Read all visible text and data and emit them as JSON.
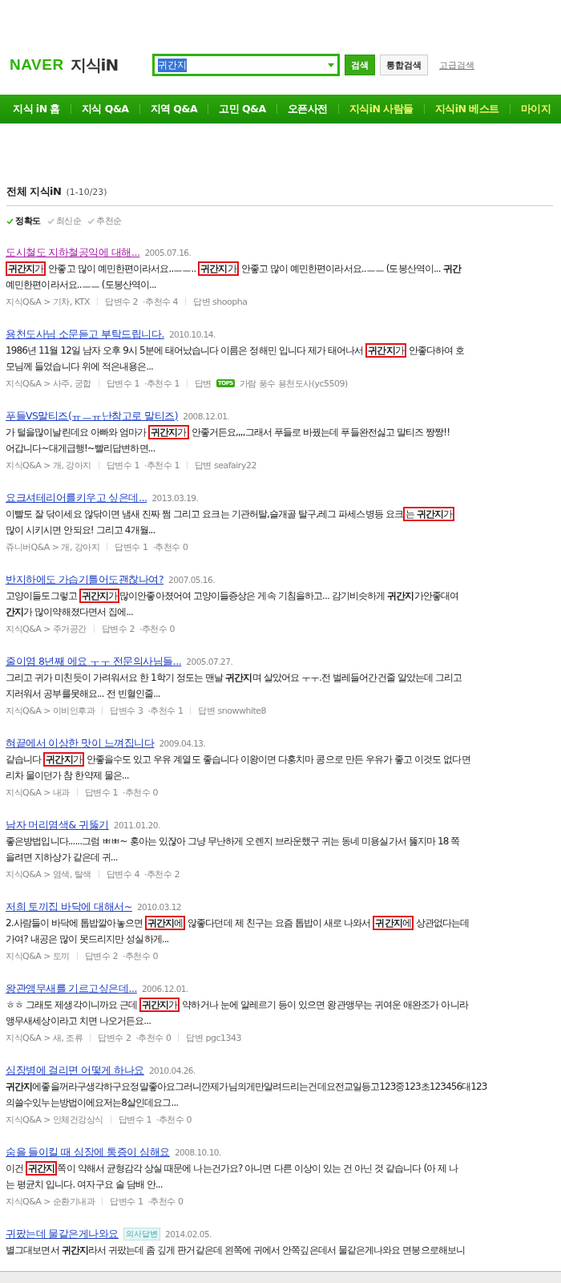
{
  "header": {
    "logo_brand": "NAVER",
    "logo_service": "지식iN",
    "search": {
      "value": "귀간지"
    },
    "buttons": [
      {
        "label": "검색",
        "kind": "primary"
      },
      {
        "label": "통합검색",
        "kind": "secondary"
      }
    ],
    "advanced_link": "고급검색"
  },
  "nav": [
    {
      "label": "지식 iN 홈",
      "kind": "main"
    },
    {
      "label": "지식 Q&A",
      "kind": "main"
    },
    {
      "label": "지역 Q&A",
      "kind": "main"
    },
    {
      "label": "고민 Q&A",
      "kind": "main"
    },
    {
      "label": "오픈사전",
      "kind": "main"
    },
    {
      "label": "지식iN 사람들",
      "kind": "special"
    },
    {
      "label": "지식iN 베스트",
      "kind": "special"
    },
    {
      "label": "마이지",
      "kind": "special"
    }
  ],
  "section": {
    "title": "전체 지식iN",
    "range": "(1-10/23)"
  },
  "sort": [
    {
      "label": "정확도",
      "selected": true
    },
    {
      "label": "최신순",
      "selected": false
    },
    {
      "label": "추천순",
      "selected": false
    }
  ],
  "results": [
    {
      "title": "도시철도 지하철공익에 대해...",
      "visited": true,
      "date": "2005.07.16.",
      "lines": [
        [
          {
            "text": "**귀간지**가",
            "kind": "boxed"
          },
          {
            "text": " 안좋고 많이 예민한편이라서요..ㅡㅡ.. ",
            "kind": "plain"
          },
          {
            "text": "**귀간지**가",
            "kind": "boxed"
          },
          {
            "text": " 안좋고 많이 예민한편이라서요..ㅡㅡ (도봉산역이... **귀간**",
            "kind": "plain"
          }
        ],
        [
          {
            "text": "예민한편이라서요..ㅡㅡ (도봉산역이...",
            "kind": "plain"
          }
        ]
      ],
      "category": "지식Q&A > 기차, KTX",
      "answers": "답변수 2",
      "recommends": "·추천수 4",
      "answerer": "답변 shoopha"
    },
    {
      "title": "용천도사님 소문듣고 부탁드립니다.",
      "visited": false,
      "date": "2010.10.14.",
      "lines": [
        [
          {
            "text": "1986년 11월 12일 남자 오후 9시 5분에 태어났습니다 이름은 정해민 입니다 제가 태어나서 ",
            "kind": "plain"
          },
          {
            "text": "**귀간지**가",
            "kind": "boxed"
          },
          {
            "text": " 안좋다하여 호",
            "kind": "plain"
          }
        ],
        [
          {
            "text": "모님께 들었습니다 위에 적은내용은...",
            "kind": "plain"
          }
        ]
      ],
      "category": "지식Q&A > 사주, 궁합",
      "answers": "답변수 1",
      "recommends": "·추천수 1",
      "answerer": "답변",
      "answerer_badge": "TOP5",
      "answerer_name": "가람 풍수 용천도사(yc5509)"
    },
    {
      "title": "푸들VS말티즈(ㅠㅡㅠ난참고로 말티즈)",
      "visited": false,
      "date": "2008.12.01.",
      "lines": [
        [
          {
            "text": "가 털을많이날린데요 아빠와 엄마가 ",
            "kind": "plain"
          },
          {
            "text": "**귀간지**가",
            "kind": "boxed"
          },
          {
            "text": " 안좋거든요,,,,그래서 푸들로 바꿨는데 푸들완전싫고 말티즈 짱짱!!",
            "kind": "plain"
          }
        ],
        [
          {
            "text": "어갑니다~대게급행!~빨리답변하면...",
            "kind": "plain"
          }
        ]
      ],
      "category": "지식Q&A > 개, 강아지",
      "answers": "답변수 1",
      "recommends": "·추천수 1",
      "answerer": "답변 seafairy22"
    },
    {
      "title": "요크셔테리어를키우고 싶은데...",
      "visited": false,
      "date": "2013.03.19.",
      "lines": [
        [
          {
            "text": "이빨도 잘 닦이세요 않닦이면 냄새 진짜 쩜 그리고 요크는 기관허탈,슬개골 탈구,레그 파세스병등 요크",
            "kind": "plain"
          },
          {
            "text": "는 **귀간지**가",
            "kind": "boxed"
          }
        ],
        [
          {
            "text": "많이 시키시면 안되요! 그리고 4개월...",
            "kind": "plain"
          }
        ]
      ],
      "category": "쥬니버Q&A > 개, 강아지",
      "answers": "답변수 1",
      "recommends": "·추천수 0"
    },
    {
      "title": "반지하에도 가습기틀어도괜찮나여?",
      "visited": false,
      "date": "2007.05.16.",
      "lines": [
        [
          {
            "text": "고양이들도그렇고 ",
            "kind": "plain"
          },
          {
            "text": "**귀간지**가",
            "kind": "boxed"
          },
          {
            "text": "많이안좋아졌어여 고양이들증상은 게속 기침을하고... 감기비슷하게 **귀간지**가안좋대여",
            "kind": "plain"
          }
        ],
        [
          {
            "text": "**간지**가 많이약해졌다면서 집에...",
            "kind": "plain"
          }
        ]
      ],
      "category": "지식Q&A > 주거공간",
      "answers": "답변수 2",
      "recommends": "·추천수 0"
    },
    {
      "title": "줄이염 8년째 에요 ㅜㅜ 전문의사님들...",
      "visited": false,
      "date": "2005.07.27.",
      "lines": [
        [
          {
            "text": "그리고 귀가 미친듯이 가려워서요 한 1학기 정도는 맨날 **귀간지**며 살았어요 ㅜㅜ.전 벌레들어간건줄 알았는데 그리고",
            "kind": "plain"
          }
        ],
        [
          {
            "text": "지러워서 공부를못해요... 전 빈혈인줄...",
            "kind": "plain"
          }
        ]
      ],
      "category": "지식Q&A > 이비인후과",
      "answers": "답변수 3",
      "recommends": "·추천수 1",
      "answerer": "답변 snowwhite8"
    },
    {
      "title": "혀끝에서 이상한 맛이 느껴집니다",
      "visited": false,
      "date": "2009.04.13.",
      "lines": [
        [
          {
            "text": "같습니다 ",
            "kind": "plain"
          },
          {
            "text": "**귀간지**가",
            "kind": "boxed"
          },
          {
            "text": " 안좋을수도 있고 우유 계열도 좋습니다 이왕이면 다홍치마 콩으로 만든 우유가 좋고 이것도 없다면",
            "kind": "plain"
          }
        ],
        [
          {
            "text": "리차 물이던가 참 한약제 물은...",
            "kind": "plain"
          }
        ]
      ],
      "category": "지식Q&A > 내과",
      "answers": "답변수 1",
      "recommends": "·추천수 0"
    },
    {
      "title": "남자 머리염색& 귀뚫기",
      "visited": false,
      "date": "2011.01.20.",
      "lines": [
        [
          {
            "text": "좋은방법입니다......그럼 ㅃㅃ~ 홍아는 있잖아 그냥 무난하게 오렌지 브라운했구 귀는 동네 미용실가서 뚫지마 18 쪽",
            "kind": "plain"
          }
        ],
        [
          {
            "text": "을려면 지하상가 같은데 귀...",
            "kind": "plain"
          }
        ]
      ],
      "category": "지식Q&A > 염색, 탈색",
      "answers": "답변수 4",
      "recommends": "·추천수 2"
    },
    {
      "title": "저희 토끼집 바닥에 대해서~",
      "visited": false,
      "date": "2010.03.12",
      "lines": [
        [
          {
            "text": "2.사람들이 바닥에 톱밥깔아놓으면 ",
            "kind": "plain"
          },
          {
            "text": "**귀간지**에",
            "kind": "boxed"
          },
          {
            "text": " 않좋다던데 제 친구는 요즘 톱밥이 새로 나와서 ",
            "kind": "plain"
          },
          {
            "text": "**귀간지**에",
            "kind": "boxed"
          },
          {
            "text": " 상관없다는데",
            "kind": "plain"
          }
        ],
        [
          {
            "text": "가여? 내공은 많이 못드리지만 성실하게...",
            "kind": "plain"
          }
        ]
      ],
      "category": "지식Q&A > 토끼",
      "answers": "답변수 2",
      "recommends": "·추천수 0"
    },
    {
      "title": "왕관앵무새를 기르고싶은데...",
      "visited": false,
      "date": "2006.12.01.",
      "lines": [
        [
          {
            "text": "ㅎㅎ 그래도 제생각이니까요 근데 ",
            "kind": "plain"
          },
          {
            "text": "**귀간지**가",
            "kind": "boxed"
          },
          {
            "text": " 약하거나 눈에 알레르기 등이 있으면 왕관앵무는 귀여운 애완조가 아니라",
            "kind": "plain"
          }
        ],
        [
          {
            "text": "앵무새세상이라고 치면 나오거든요...",
            "kind": "plain"
          }
        ]
      ],
      "category": "지식Q&A > 새, 조류",
      "answers": "답변수 2",
      "recommends": "·추천수 0",
      "answerer": "답변 pgc1343"
    },
    {
      "title": "심장병에 걸리면 어떻게 하나요",
      "visited": false,
      "date": "2010.04.26.",
      "lines": [
        [
          {
            "text": "**귀간지**에좋을꺼라구생각하구요정말좋아요그러니깐제가님의게만알려드리는건데요전교일등고123중123초123456대123",
            "kind": "plain"
          }
        ],
        [
          {
            "text": "의쓸수있누는방법이에요저는8살인데요그...",
            "kind": "plain"
          }
        ]
      ],
      "category": "지식Q&A > 인체건강상식",
      "answers": "답변수 1",
      "recommends": "·추천수 0"
    },
    {
      "title": "숨을 들이킬 때 심장에 통증이 심해요",
      "visited": false,
      "date": "2008.10.10.",
      "lines": [
        [
          {
            "text": "이건 ",
            "kind": "plain"
          },
          {
            "text": "**귀간지** ",
            "kind": "boxed"
          },
          {
            "text": "쪽이 약해서 균형감각 상실 때문에 나는건가요? 아니면 다른 이상이 있는 건 아닌 것 같습니다 (아 제 나",
            "kind": "plain"
          }
        ],
        [
          {
            "text": "는 평균치 입니다. 여자구요 술 담배 안...",
            "kind": "plain"
          }
        ]
      ],
      "category": "지식Q&A > 순환기내과",
      "answers": "답변수 1",
      "recommends": "·추천수 0"
    },
    {
      "title": "귀팠는데 물같은게나와요",
      "visited": false,
      "badge": "의사답변",
      "date": "2014.02.05.",
      "lines": [
        [
          {
            "text": "별그대보면서 **귀간지**라서 귀팠는데 좀 깊게 판거같은데 왼쪽에 귀에서 안쪽깊은데서 물같은게나와요 면봉으로해보니",
            "kind": "plain"
          }
        ]
      ]
    }
  ]
}
